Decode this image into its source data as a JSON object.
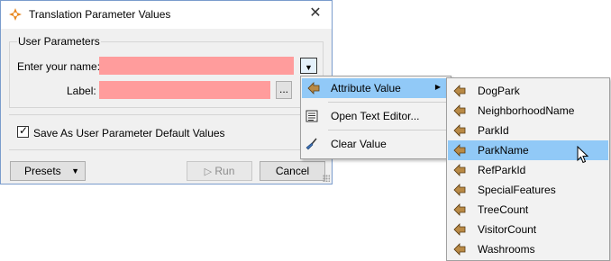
{
  "dialog": {
    "title": "Translation Parameter Values",
    "close_glyph": "✕",
    "group_label": "User Parameters",
    "name_label": "Enter your name:",
    "label_label": "Label:",
    "dropdown_glyph": "▼",
    "browse_label": "...",
    "checkbox_checked": true,
    "checkbox_label": "Save As User Parameter Default Values",
    "presets_label": "Presets",
    "run_label": "Run",
    "cancel_label": "Cancel"
  },
  "context_menu": {
    "items": [
      {
        "label": "Attribute Value",
        "icon": "attribute-arrow-icon",
        "submenu_glyph": "▶"
      },
      {
        "label": "Open Text Editor...",
        "icon": "text-editor-icon"
      },
      {
        "label": "Clear Value",
        "icon": "broom-icon"
      }
    ]
  },
  "submenu": {
    "highlighted": "ParkName",
    "items": [
      {
        "label": "DogPark"
      },
      {
        "label": "NeighborhoodName"
      },
      {
        "label": "ParkId"
      },
      {
        "label": "ParkName"
      },
      {
        "label": "RefParkId"
      },
      {
        "label": "SpecialFeatures"
      },
      {
        "label": "TreeCount"
      },
      {
        "label": "VisitorCount"
      },
      {
        "label": "Washrooms"
      }
    ]
  },
  "colors": {
    "required_field": "#ff9c9c",
    "highlight": "#91c9f7",
    "attribute_icon": "#b98a46"
  }
}
